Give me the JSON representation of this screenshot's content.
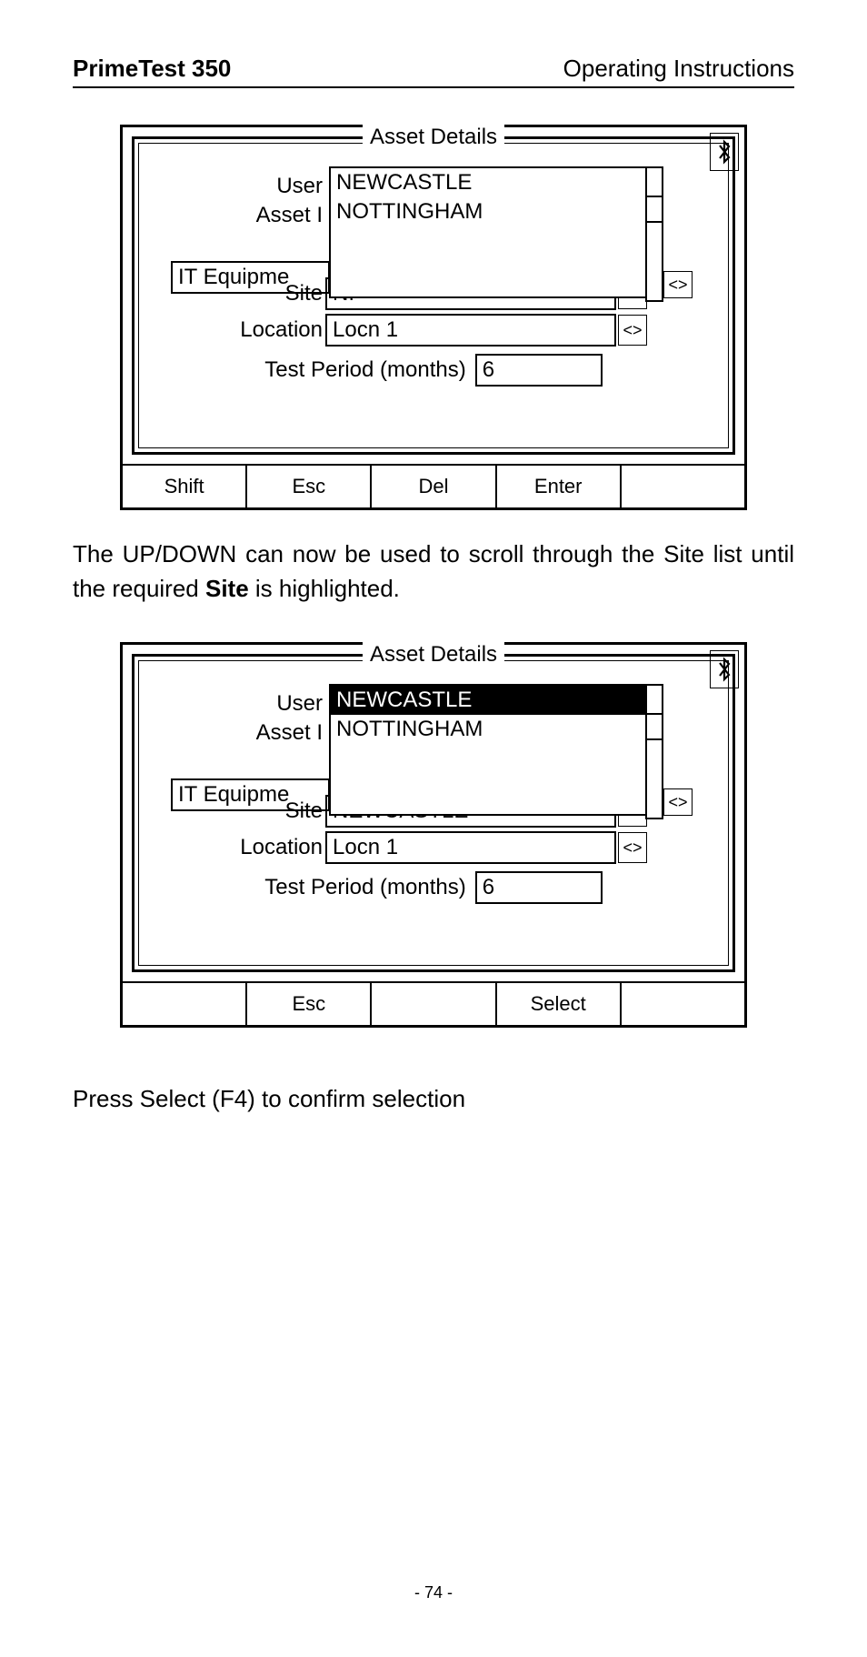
{
  "header": {
    "left": "PrimeTest 350",
    "right": "Operating Instructions"
  },
  "screenshot1": {
    "frame_title": "Asset Details",
    "user_label": "User",
    "asset_label": "Asset I",
    "it_equip": "IT Equipme",
    "dropdown": {
      "items": [
        "NEWCASTLE",
        "NOTTINGHAM"
      ],
      "selected_index": -1
    },
    "site_label": "Site",
    "site_value": "NI",
    "location_label": "Location",
    "location_value": "Locn 1",
    "test_period_label": "Test Period (months)",
    "test_period_value": "6",
    "toolbar": [
      "Shift",
      "Esc",
      "Del",
      "Enter",
      ""
    ]
  },
  "paragraph1": {
    "pre": "The UP/DOWN can now be used to scroll through the Site list until the required ",
    "bold": "Site",
    "post": " is highlighted."
  },
  "screenshot2": {
    "frame_title": "Asset Details",
    "user_label": "User",
    "asset_label": "Asset I",
    "it_equip": "IT Equipme",
    "dropdown": {
      "items": [
        "NEWCASTLE",
        "NOTTINGHAM"
      ],
      "selected_index": 0
    },
    "site_label": "Site",
    "site_value": "NEWCASTLE",
    "location_label": "Location",
    "location_value": "Locn 1",
    "test_period_label": "Test Period (months)",
    "test_period_value": "6",
    "toolbar": [
      "",
      "Esc",
      "",
      "Select",
      ""
    ]
  },
  "paragraph2": "Press Select (F4) to confirm selection",
  "page_number": "- 74 -",
  "chevron_glyph": "<>"
}
